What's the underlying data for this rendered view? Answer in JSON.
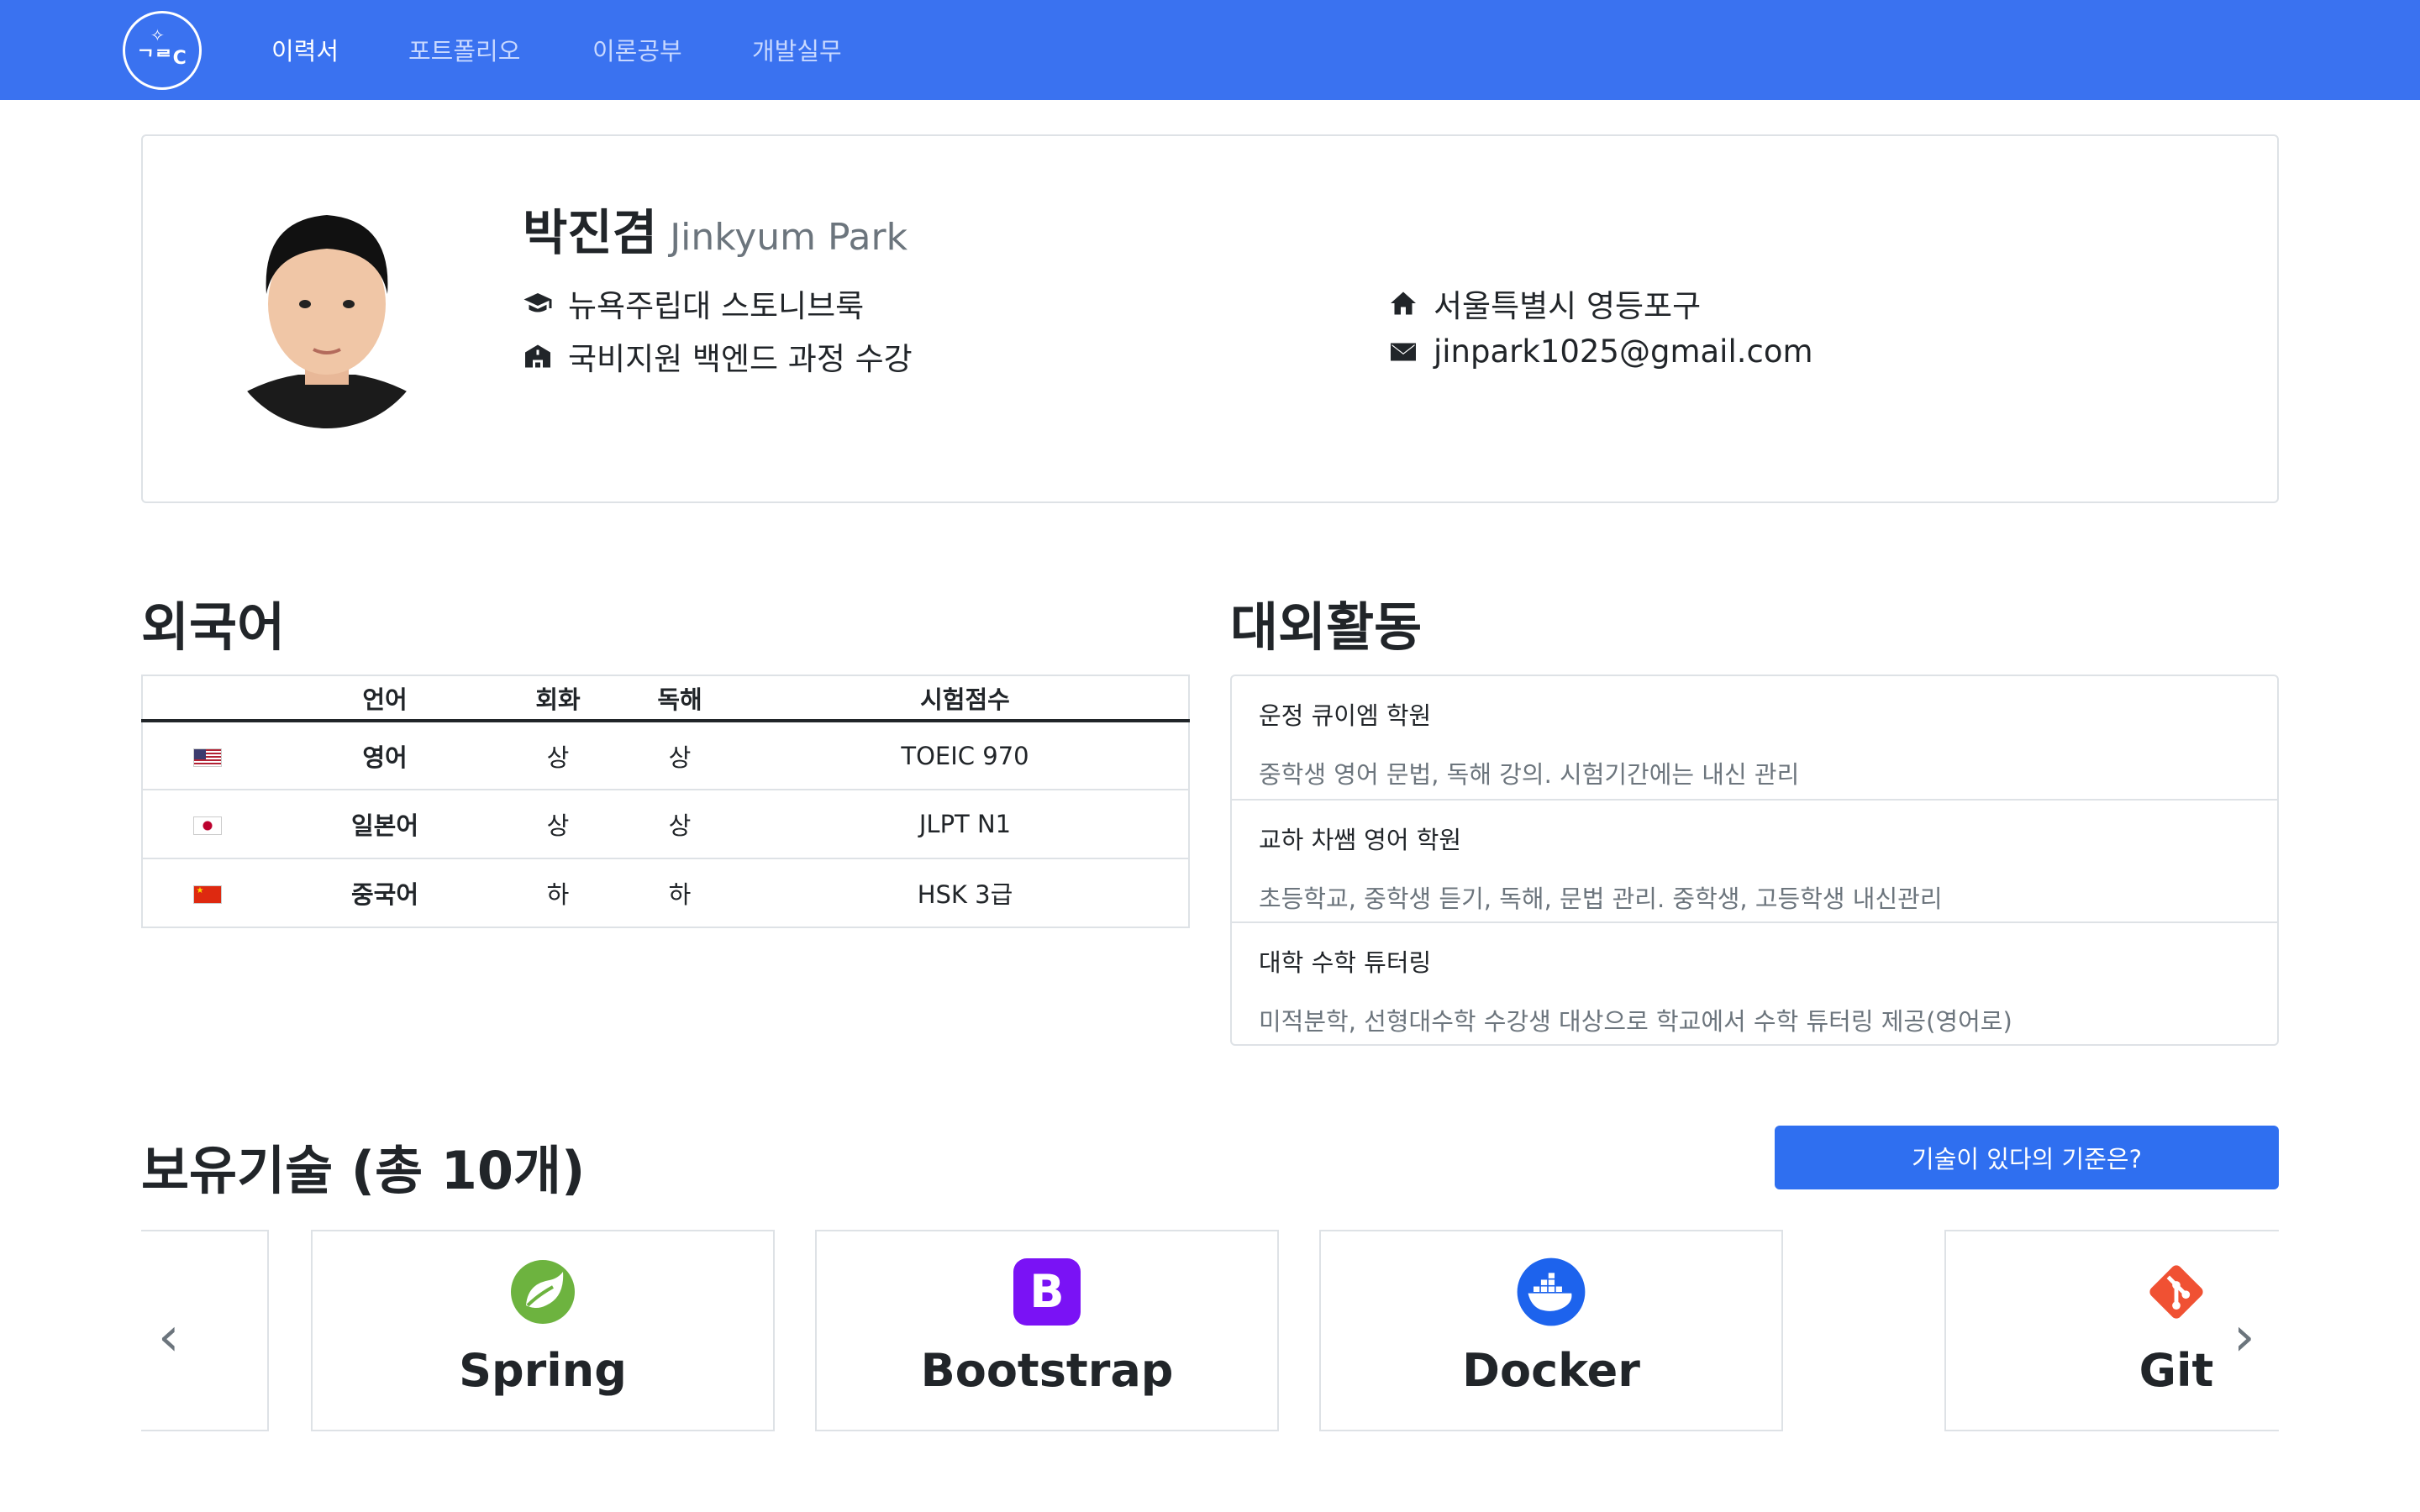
{
  "nav": {
    "logo_text": "ᄀᄅC",
    "links": [
      {
        "label": "이력서",
        "active": true
      },
      {
        "label": "포트폴리오",
        "active": false
      },
      {
        "label": "이론공부",
        "active": false
      },
      {
        "label": "개발실무",
        "active": false
      }
    ]
  },
  "profile": {
    "name_ko": "박진겸",
    "name_en": "Jinkyum Park",
    "school": "뉴욕주립대 스토니브룩",
    "course": "국비지원 백엔드 과정 수강",
    "address": "서울특별시 영등포구",
    "email": "jinpark1025@gmail.com"
  },
  "languages": {
    "title": "외국어",
    "headers": [
      "언어",
      "회화",
      "독해",
      "시험점수"
    ],
    "rows": [
      {
        "flag": "us-flag",
        "lang": "영어",
        "speaking": "상",
        "reading": "상",
        "score": "TOEIC 970"
      },
      {
        "flag": "jp-flag",
        "lang": "일본어",
        "speaking": "상",
        "reading": "상",
        "score": "JLPT N1"
      },
      {
        "flag": "cn-flag",
        "lang": "중국어",
        "speaking": "하",
        "reading": "하",
        "score": "HSK 3급"
      }
    ]
  },
  "activities": {
    "title": "대외활동",
    "items": [
      {
        "title": "운정 큐이엠 학원",
        "desc": "중학생 영어 문법, 독해 강의. 시험기간에는 내신 관리"
      },
      {
        "title": "교하 차쌤 영어 학원",
        "desc": "초등학교, 중학생 듣기, 독해, 문법 관리. 중학생, 고등학생 내신관리"
      },
      {
        "title": "대학 수학 튜터링",
        "desc": "미적분학, 선형대수학 수강생 대상으로 학교에서 수학 튜터링 제공(영어로)"
      }
    ]
  },
  "skills": {
    "title": "보유기술 (총 10개)",
    "criteria_button": "기술이 있다의 기준은?",
    "cards": [
      {
        "name": "Spring",
        "icon": "spring-icon"
      },
      {
        "name": "Bootstrap",
        "icon": "bootstrap-icon"
      },
      {
        "name": "Docker",
        "icon": "docker-icon"
      },
      {
        "name": "Git",
        "icon": "git-icon"
      }
    ],
    "prev": "‹",
    "next": "›"
  },
  "colors": {
    "navbar": "#3a72f0",
    "button": "#2f6ff0",
    "spring": "#6db33f",
    "bootstrap": "#7a12f5",
    "docker": "#1d63ed",
    "git": "#f05133"
  }
}
